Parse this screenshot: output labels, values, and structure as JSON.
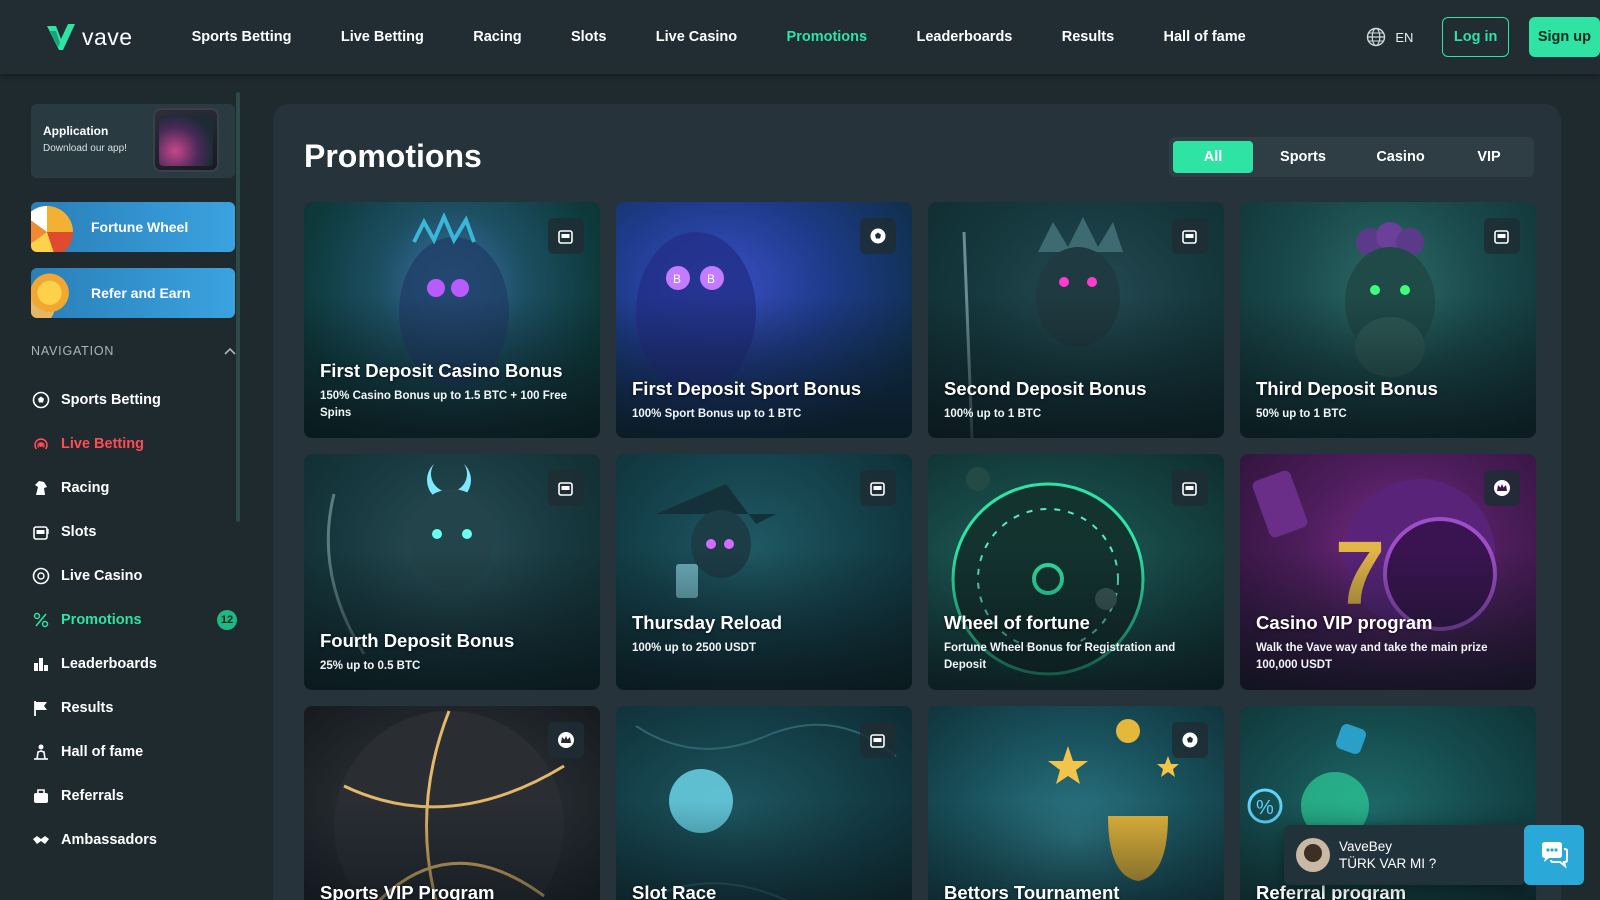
{
  "brand": {
    "name": "vave",
    "accent": "#2fe3a4"
  },
  "topnav": {
    "items": [
      {
        "label": "Sports Betting",
        "active": false
      },
      {
        "label": "Live Betting",
        "active": false
      },
      {
        "label": "Racing",
        "active": false
      },
      {
        "label": "Slots",
        "active": false
      },
      {
        "label": "Live Casino",
        "active": false
      },
      {
        "label": "Promotions",
        "active": true
      },
      {
        "label": "Leaderboards",
        "active": false
      },
      {
        "label": "Results",
        "active": false
      },
      {
        "label": "Hall of fame",
        "active": false
      }
    ],
    "language": "EN",
    "login_label": "Log in",
    "signup_label": "Sign up"
  },
  "sidebar": {
    "app_card": {
      "title": "Application",
      "subtitle": "Download our app!"
    },
    "promos": [
      {
        "label": "Fortune Wheel",
        "icon": "fortune-wheel-icon"
      },
      {
        "label": "Refer and Earn",
        "icon": "coins-icon"
      }
    ],
    "nav_heading": "NAVIGATION",
    "items": [
      {
        "label": "Sports Betting",
        "icon": "soccer-ball-icon"
      },
      {
        "label": "Live Betting",
        "icon": "broadcast-icon",
        "state": "live"
      },
      {
        "label": "Racing",
        "icon": "horse-icon"
      },
      {
        "label": "Slots",
        "icon": "slot-machine-icon"
      },
      {
        "label": "Live Casino",
        "icon": "chip-icon"
      },
      {
        "label": "Promotions",
        "icon": "promotions-icon",
        "state": "active",
        "badge": "12"
      },
      {
        "label": "Leaderboards",
        "icon": "leaderboard-icon"
      },
      {
        "label": "Results",
        "icon": "flag-icon"
      },
      {
        "label": "Hall of fame",
        "icon": "podium-icon"
      },
      {
        "label": "Referrals",
        "icon": "referral-bag-icon"
      },
      {
        "label": "Ambassadors",
        "icon": "handshake-icon"
      }
    ]
  },
  "main": {
    "title": "Promotions",
    "filters": [
      {
        "label": "All",
        "active": true
      },
      {
        "label": "Sports",
        "active": false
      },
      {
        "label": "Casino",
        "active": false
      },
      {
        "label": "VIP",
        "active": false
      }
    ],
    "cards": [
      {
        "title": "First Deposit Casino Bonus",
        "desc": "150% Casino Bonus up to 1.5 BTC + 100 Free Spins",
        "tag_icon": "slot-machine-icon"
      },
      {
        "title": "First Deposit Sport Bonus",
        "desc": "100% Sport Bonus up to 1 BTC",
        "tag_icon": "soccer-ball-icon"
      },
      {
        "title": "Second Deposit Bonus",
        "desc": "100% up to 1 BTC",
        "tag_icon": "slot-machine-icon"
      },
      {
        "title": "Third Deposit Bonus",
        "desc": "50% up to 1 BTC",
        "tag_icon": "slot-machine-icon"
      },
      {
        "title": "Fourth Deposit Bonus",
        "desc": "25% up to 0.5 BTC",
        "tag_icon": "slot-machine-icon"
      },
      {
        "title": "Thursday Reload",
        "desc": "100% up to 2500 USDT",
        "tag_icon": "slot-machine-icon"
      },
      {
        "title": "Wheel of fortune",
        "desc": "Fortune Wheel Bonus for Registration and Deposit",
        "tag_icon": "slot-machine-icon"
      },
      {
        "title": "Casino VIP program",
        "desc": "Walk the Vave way and take the main prize 100,000 USDT",
        "tag_icon": "crown-icon"
      },
      {
        "title": "Sports VIP Program",
        "desc": "",
        "tag_icon": "crown-icon"
      },
      {
        "title": "Slot Race",
        "desc": "",
        "tag_icon": "slot-machine-icon"
      },
      {
        "title": "Bettors Tournament",
        "desc": "",
        "tag_icon": "soccer-ball-icon"
      },
      {
        "title": "Referral program",
        "desc": "",
        "tag_icon": ""
      }
    ]
  },
  "chat": {
    "name": "VaveBey",
    "message": "TÜRK VAR MI ?"
  }
}
